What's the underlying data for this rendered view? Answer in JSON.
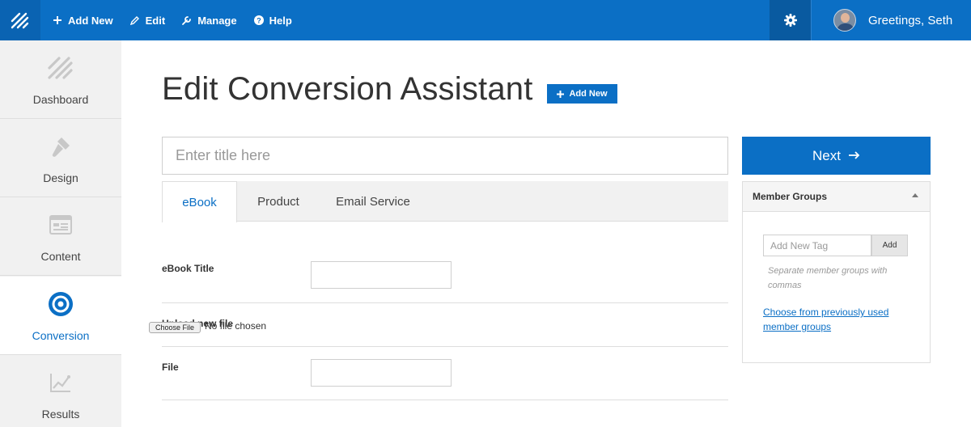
{
  "topbar": {
    "nav": [
      {
        "label": "Add New",
        "icon": "plus-icon"
      },
      {
        "label": "Edit",
        "icon": "pencil-icon"
      },
      {
        "label": "Manage",
        "icon": "wrench-icon"
      },
      {
        "label": "Help",
        "icon": "help-icon"
      }
    ],
    "settings_icon": "gear-icon",
    "greeting": "Greetings, Seth",
    "colors": {
      "bar": "#0b6fc5",
      "logo_bg": "#0a63b2",
      "gear_bg": "#095aa0"
    }
  },
  "sidebar": {
    "items": [
      {
        "label": "Dashboard",
        "icon": "dashboard-stripes-icon"
      },
      {
        "label": "Design",
        "icon": "paintbrush-icon"
      },
      {
        "label": "Content",
        "icon": "content-layout-icon"
      },
      {
        "label": "Conversion",
        "icon": "target-icon",
        "active": true
      },
      {
        "label": "Results",
        "icon": "line-chart-icon"
      }
    ]
  },
  "main": {
    "title": "Edit Conversion Assistant",
    "add_new_label": "Add New",
    "title_placeholder": "Enter title here",
    "tabs": [
      {
        "label": "eBook",
        "active": true
      },
      {
        "label": "Product"
      },
      {
        "label": "Email Service"
      }
    ],
    "fields": {
      "ebook_title_label": "eBook Title",
      "upload_label": "Upload new file",
      "choose_file_label": "Choose File",
      "no_file_text": "No file chosen",
      "file_label": "File"
    }
  },
  "panel": {
    "next_label": "Next",
    "member_groups_title": "Member Groups",
    "tag_placeholder": "Add New Tag",
    "add_label": "Add",
    "help_text": "Separate member groups with commas",
    "choose_link": "Choose from previously used member groups"
  },
  "colors": {
    "accent": "#0b6fc5",
    "sidebar_bg": "#f1f1f1"
  }
}
